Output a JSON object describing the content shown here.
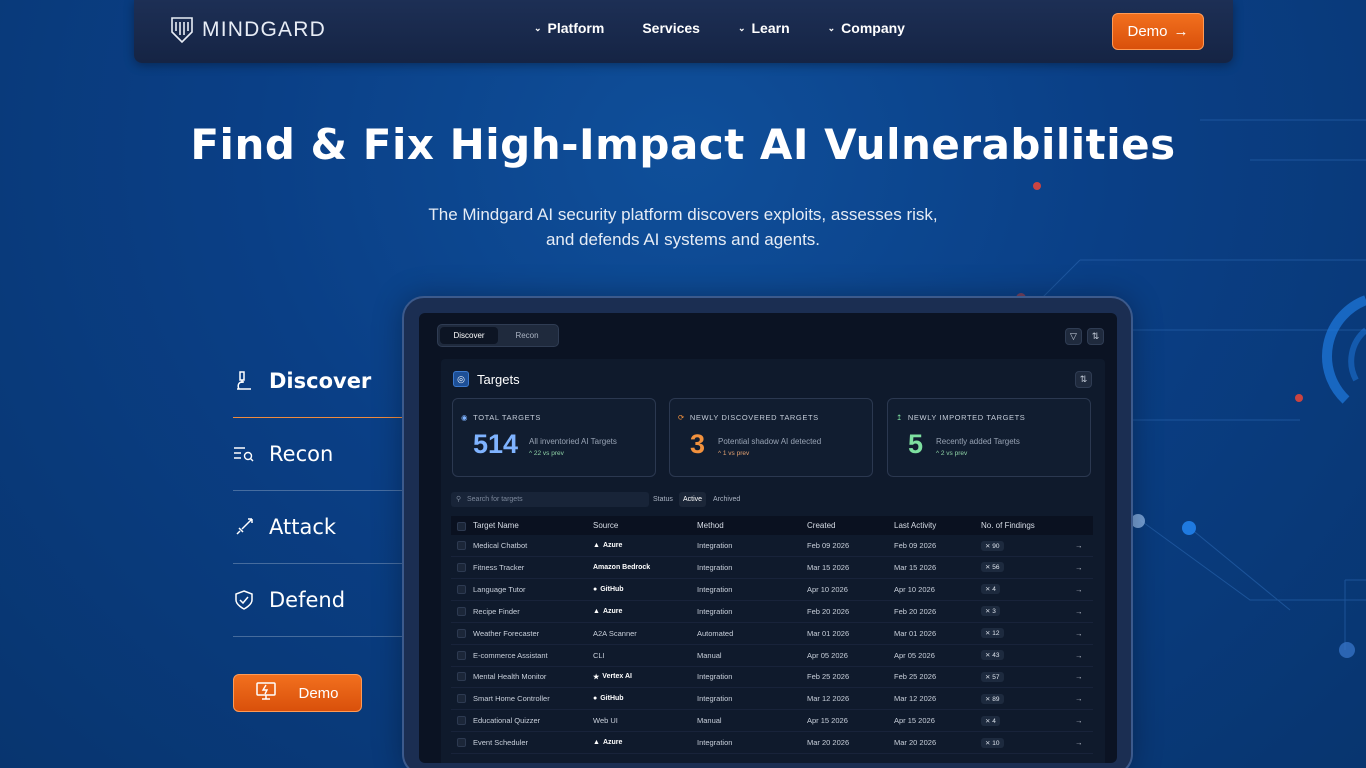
{
  "brand": {
    "name": "MINDGARD"
  },
  "nav": {
    "links": [
      {
        "label": "Platform",
        "dropdown": true
      },
      {
        "label": "Services",
        "dropdown": false
      },
      {
        "label": "Learn",
        "dropdown": true
      },
      {
        "label": "Company",
        "dropdown": true
      }
    ],
    "demo_label": "Demo"
  },
  "hero": {
    "title": "Find & Fix High-Impact AI Vulnerabilities",
    "subtitle": "The Mindgard AI security platform discovers exploits, assesses risk, and defends AI systems and agents."
  },
  "tabs": [
    {
      "label": "Discover",
      "icon": "microscope-icon",
      "active": true
    },
    {
      "label": "Recon",
      "icon": "list-search-icon",
      "active": false
    },
    {
      "label": "Attack",
      "icon": "sword-icon",
      "active": false
    },
    {
      "label": "Defend",
      "icon": "shield-check-icon",
      "active": false
    }
  ],
  "left_demo_label": "Demo",
  "app": {
    "segments": [
      "Discover",
      "Recon"
    ],
    "panel_title": "Targets",
    "stats": [
      {
        "label": "TOTAL TARGETS",
        "value": "514",
        "desc": "All inventoried AI Targets",
        "delta": "22 vs prev",
        "color": "#7fb3ff"
      },
      {
        "label": "NEWLY DISCOVERED TARGETS",
        "value": "3",
        "desc": "Potential shadow AI detected",
        "delta": "1 vs prev",
        "color": "#f2913d"
      },
      {
        "label": "NEWLY IMPORTED TARGETS",
        "value": "5",
        "desc": "Recently added Targets",
        "delta": "2 vs prev",
        "color": "#7ee0a0"
      }
    ],
    "search_placeholder": "Search for targets",
    "status_label": "Status",
    "filters": [
      "Active",
      "Archived"
    ],
    "columns": [
      "Target Name",
      "Source",
      "Method",
      "Created",
      "Last Activity",
      "No. of Findings"
    ],
    "rows": [
      {
        "name": "Medical Chatbot",
        "source": "Azure",
        "method": "Integration",
        "created": "Feb 09 2026",
        "last": "Feb 09 2026",
        "findings": "90"
      },
      {
        "name": "Fitness Tracker",
        "source": "Amazon Bedrock",
        "method": "Integration",
        "created": "Mar 15 2026",
        "last": "Mar 15 2026",
        "findings": "56"
      },
      {
        "name": "Language Tutor",
        "source": "GitHub",
        "method": "Integration",
        "created": "Apr 10 2026",
        "last": "Apr 10 2026",
        "findings": "4"
      },
      {
        "name": "Recipe Finder",
        "source": "Azure",
        "method": "Integration",
        "created": "Feb 20 2026",
        "last": "Feb 20 2026",
        "findings": "3"
      },
      {
        "name": "Weather Forecaster",
        "source": "A2A Scanner",
        "method": "Automated",
        "created": "Mar 01 2026",
        "last": "Mar 01 2026",
        "findings": "12"
      },
      {
        "name": "E-commerce Assistant",
        "source": "CLI",
        "method": "Manual",
        "created": "Apr 05 2026",
        "last": "Apr 05 2026",
        "findings": "43"
      },
      {
        "name": "Mental Health Monitor",
        "source": "Vertex AI",
        "method": "Integration",
        "created": "Feb 25 2026",
        "last": "Feb 25 2026",
        "findings": "57"
      },
      {
        "name": "Smart Home Controller",
        "source": "GitHub",
        "method": "Integration",
        "created": "Mar 12 2026",
        "last": "Mar 12 2026",
        "findings": "89"
      },
      {
        "name": "Educational Quizzer",
        "source": "Web UI",
        "method": "Manual",
        "created": "Apr 15 2026",
        "last": "Apr 15 2026",
        "findings": "4"
      },
      {
        "name": "Event Scheduler",
        "source": "Azure",
        "method": "Integration",
        "created": "Mar 20 2026",
        "last": "Mar 20 2026",
        "findings": "10"
      }
    ]
  }
}
